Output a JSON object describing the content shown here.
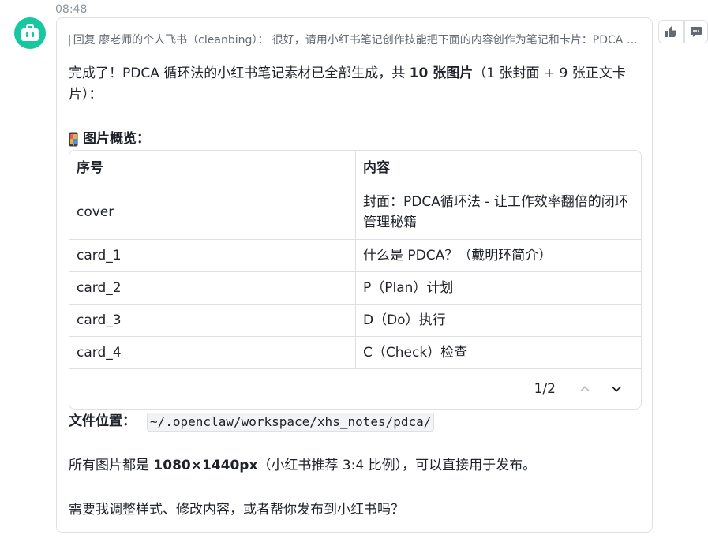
{
  "message": {
    "time": "08:48",
    "reply_prefix": "|",
    "reply_quote": "回复 廖老师的个人飞书（cleanbing）： 很好，请用小红书笔记创作技能把下面的内容创作为笔记和卡片：PDCA 循环法 - 让工作效率翻倍的闭环管理秘籍",
    "intro_before": "完成了！PDCA 循环法的小红书笔记素材已全部生成，共 ",
    "intro_bold": "10 张图片",
    "intro_after": "（1 张封面 + 9 张正文卡片）：",
    "section_title": "图片概览：",
    "file_label": "文件位置：",
    "file_path": "~/.openclaw/workspace/xhs_notes/pdca/",
    "size_before": "所有图片都是 ",
    "size_bold": "1080×1440px",
    "size_after": "（小红书推荐 3:4 比例），可以直接用于发布。",
    "question": "需要我调整样式、修改内容，或者帮你发布到小红书吗？"
  },
  "table": {
    "headers": [
      "序号",
      "内容"
    ],
    "rows": [
      [
        "cover",
        "封面：PDCA循环法 - 让工作效率翻倍的闭环管理秘籍"
      ],
      [
        "card_1",
        "什么是 PDCA？（戴明环简介）"
      ],
      [
        "card_2",
        "P（Plan）计划"
      ],
      [
        "card_3",
        "D（Do）执行"
      ],
      [
        "card_4",
        "C（Check）检查"
      ]
    ],
    "pager": "1/2"
  },
  "icons": {
    "avatar": "briefcase-icon",
    "like": "thumbs-up-icon",
    "comment": "comment-icon",
    "section": "mobile-phone-icon",
    "prev": "chevron-up-icon",
    "next": "chevron-down-icon"
  },
  "colors": {
    "avatar_bg": "#17c7a0",
    "border": "#dee0e3",
    "muted_text": "#8f959e",
    "code_bg": "#f2f3f5"
  }
}
